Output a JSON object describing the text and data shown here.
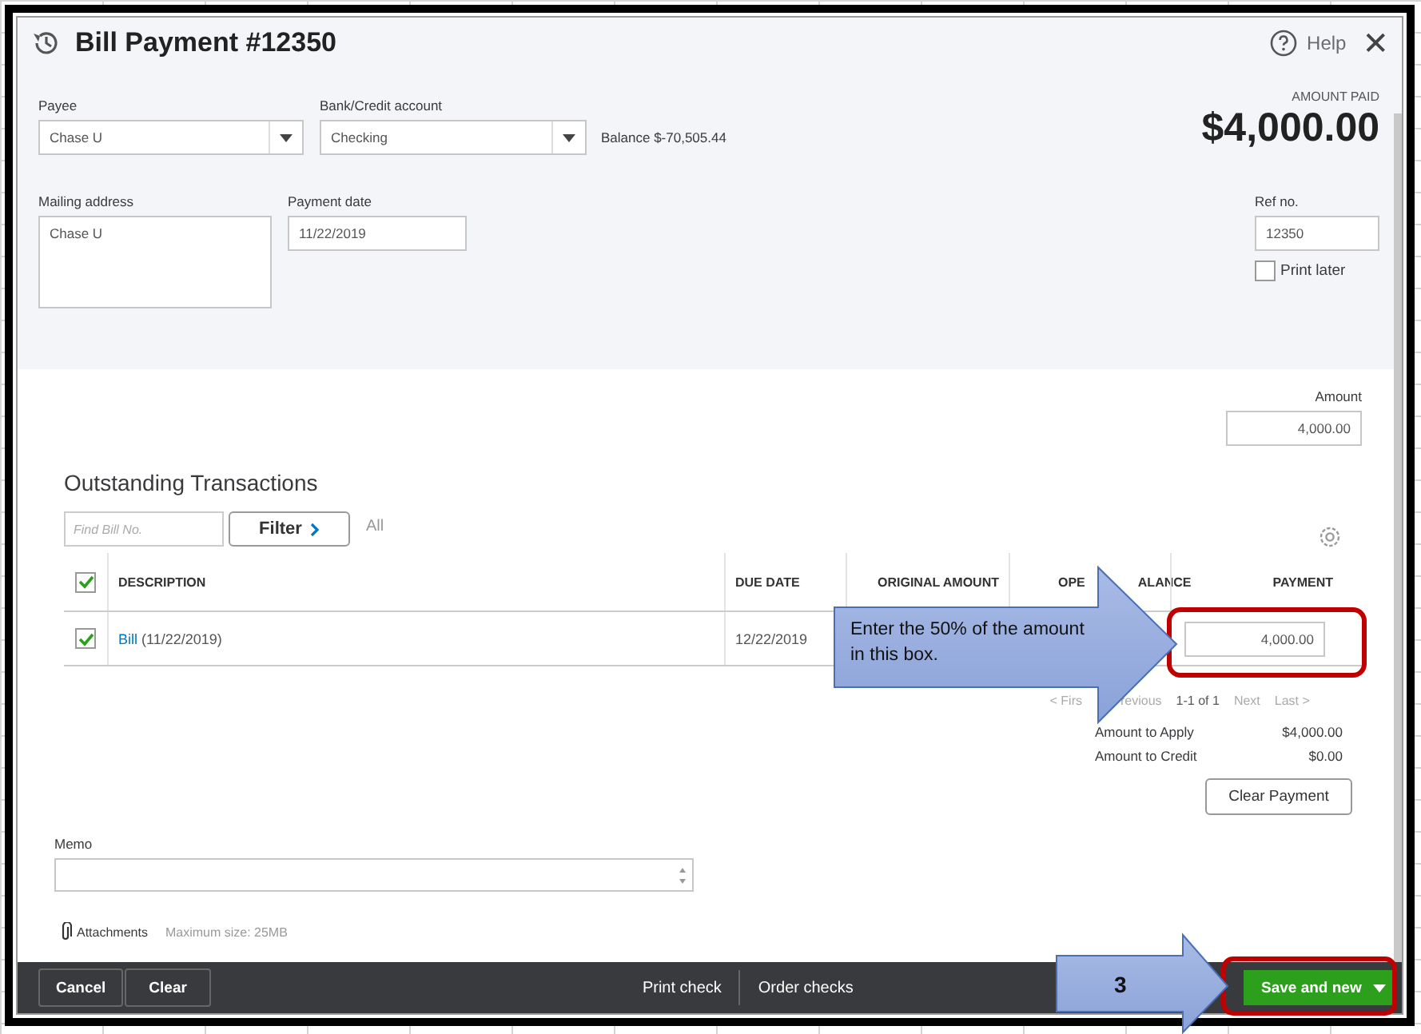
{
  "window": {
    "title": "Bill Payment #12350",
    "help": "Help",
    "close": "✕"
  },
  "header": {
    "payee": {
      "label": "Payee",
      "value": "Chase U"
    },
    "bank_account": {
      "label": "Bank/Credit account",
      "value": "Checking"
    },
    "balance": "Balance $-70,505.44",
    "amount_paid": {
      "label": "AMOUNT PAID",
      "value": "$4,000.00"
    },
    "mailing_address": {
      "label": "Mailing address",
      "value": "Chase U"
    },
    "payment_date": {
      "label": "Payment date",
      "value": "11/22/2019"
    },
    "ref_no": {
      "label": "Ref no.",
      "value": "12350"
    },
    "print_later": {
      "label": "Print later",
      "checked": false
    }
  },
  "amount": {
    "label": "Amount",
    "value": "4,000.00"
  },
  "outstanding": {
    "title": "Outstanding Transactions",
    "search": {
      "placeholder": "Find Bill No."
    },
    "filter": "Filter",
    "filter_value": "All",
    "select_all_checked": true,
    "columns": [
      "DESCRIPTION",
      "DUE DATE",
      "ORIGINAL AMOUNT",
      [
        "OPE",
        "ALANCE"
      ],
      "PAYMENT"
    ],
    "rows": [
      {
        "checked": true,
        "link": "Bill",
        "description": "(11/22/2019)",
        "due_date": "12/22/2019",
        "payment": "4,000.00"
      }
    ],
    "pagination": {
      "first": "< Firs",
      "previous": "revious",
      "range": "1-1 of 1",
      "next": "Next",
      "last": "Last >"
    }
  },
  "totals": [
    {
      "label": "Amount to Apply",
      "value": "$4,000.00"
    },
    {
      "label": "Amount to Credit",
      "value": "$0.00"
    }
  ],
  "clear_payment": "Clear Payment",
  "memo": {
    "label": "Memo"
  },
  "attachments": {
    "label": "Attachments",
    "note": "Maximum size: 25MB"
  },
  "footer": {
    "cancel": "Cancel",
    "clear": "Clear",
    "links": [
      "Print check",
      "Order checks"
    ],
    "save": "Save and new"
  },
  "annotations": [
    {
      "text": "Enter the 50% of the amount in this box."
    },
    {
      "text": "3"
    }
  ]
}
